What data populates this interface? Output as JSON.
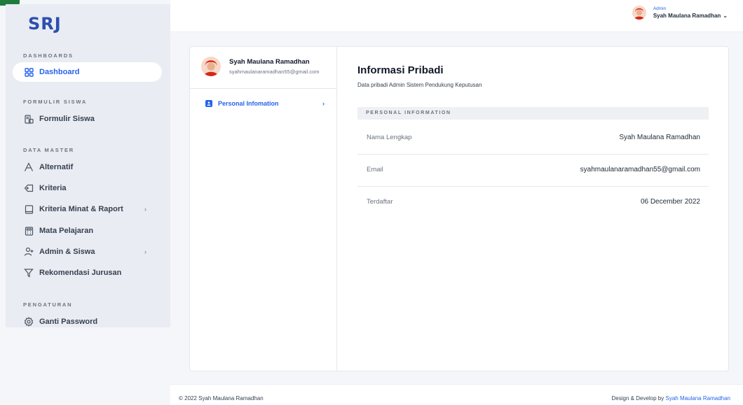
{
  "app": {
    "logo": "SRJ"
  },
  "sidebar": {
    "sections": [
      {
        "title": "DASHBOARDS"
      },
      {
        "title": "FORMULIR SISWA"
      },
      {
        "title": "DATA MASTER"
      },
      {
        "title": "PENGATURAN"
      }
    ],
    "items": [
      {
        "label": "Dashboard",
        "icon": "dashboard-grid-icon",
        "active": true
      },
      {
        "label": "Formulir Siswa",
        "icon": "form-icon"
      },
      {
        "label": "Alternatif",
        "icon": "letter-a-icon"
      },
      {
        "label": "Kriteria",
        "icon": "tag-icon"
      },
      {
        "label": "Kriteria Minat & Raport",
        "icon": "book-icon",
        "has_submenu": true
      },
      {
        "label": "Mata Pelajaran",
        "icon": "calculator-icon"
      },
      {
        "label": "Admin & Siswa",
        "icon": "user-add-icon",
        "has_submenu": true
      },
      {
        "label": "Rekomendasi Jurusan",
        "icon": "filter-icon"
      },
      {
        "label": "Ganti Password",
        "icon": "gear-icon"
      }
    ],
    "submenu_chevron": "›"
  },
  "topbar": {
    "user_role": "Admin",
    "user_name": "Syah Maulana Ramadhan",
    "caret": "⌄"
  },
  "profile": {
    "name": "Syah Maulana Ramadhan",
    "email": "syahmaulanaramadhan55@gmail.com",
    "menu_label": "Personal Infomation",
    "menu_chevron": "›"
  },
  "content": {
    "title": "Informasi Pribadi",
    "subtitle": "Data pribadi Admin Sistem Pendukung Keputusan",
    "section_header": "PERSONAL INFORMATION",
    "rows": [
      {
        "label": "Nama Lengkap",
        "value": "Syah Maulana Ramadhan"
      },
      {
        "label": "Email",
        "value": "syahmaulanaramadhan55@gmail.com"
      },
      {
        "label": "Terdaftar",
        "value": "06 December 2022"
      }
    ]
  },
  "footer": {
    "copyright": "© 2022 Syah Maulana Ramadhan",
    "credit_prefix": "Design & Develop by",
    "credit_link": "Syah Maulana Ramadhan"
  },
  "colors": {
    "accent": "#2563eb",
    "logo": "#2d4fb0",
    "sidebar_bg": "#e9ecf2",
    "page_bg": "#f5f6fa"
  }
}
